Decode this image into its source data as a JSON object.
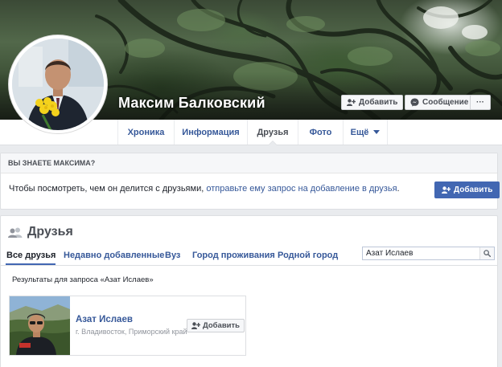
{
  "profile": {
    "name": "Максим Балковский",
    "add_friend_label": "Добавить",
    "message_label": "Сообщение",
    "more_label": "···"
  },
  "tabs": [
    {
      "label": "Хроника",
      "active": false
    },
    {
      "label": "Информация",
      "active": false
    },
    {
      "label": "Друзья",
      "active": true
    },
    {
      "label": "Фото",
      "active": false
    },
    {
      "label": "Ещё",
      "active": false,
      "has_dropdown": true
    }
  ],
  "know_card": {
    "heading": "ВЫ ЗНАЕТЕ МАКСИМА?",
    "text_before": "Чтобы посмотреть, чем он делится с друзьями,",
    "link_text": "отправьте ему запрос на добавление в друзья",
    "text_after": ".",
    "button_label": "Добавить"
  },
  "friends": {
    "title": "Друзья",
    "subtabs": [
      {
        "label": "Все друзья",
        "active": true
      },
      {
        "label": "Недавно добавленные",
        "active": false
      },
      {
        "label": "Вуз",
        "active": false
      },
      {
        "label": "Город проживания",
        "active": false
      },
      {
        "label": "Родной город",
        "active": false
      }
    ],
    "search_value": "Азат Ислаев",
    "results_label": "Результаты для запроса «Азат Ислаев»",
    "items": [
      {
        "name": "Азат Ислаев",
        "location": "г. Владивосток, Приморский край",
        "button_label": "Добавить"
      }
    ]
  },
  "colors": {
    "link": "#365899",
    "primary_button": "#4267b2",
    "page_background": "#e9ebee"
  },
  "icons": [
    "add-friend-icon",
    "messenger-icon",
    "friends-icon",
    "search-icon",
    "dropdown-caret-icon"
  ]
}
